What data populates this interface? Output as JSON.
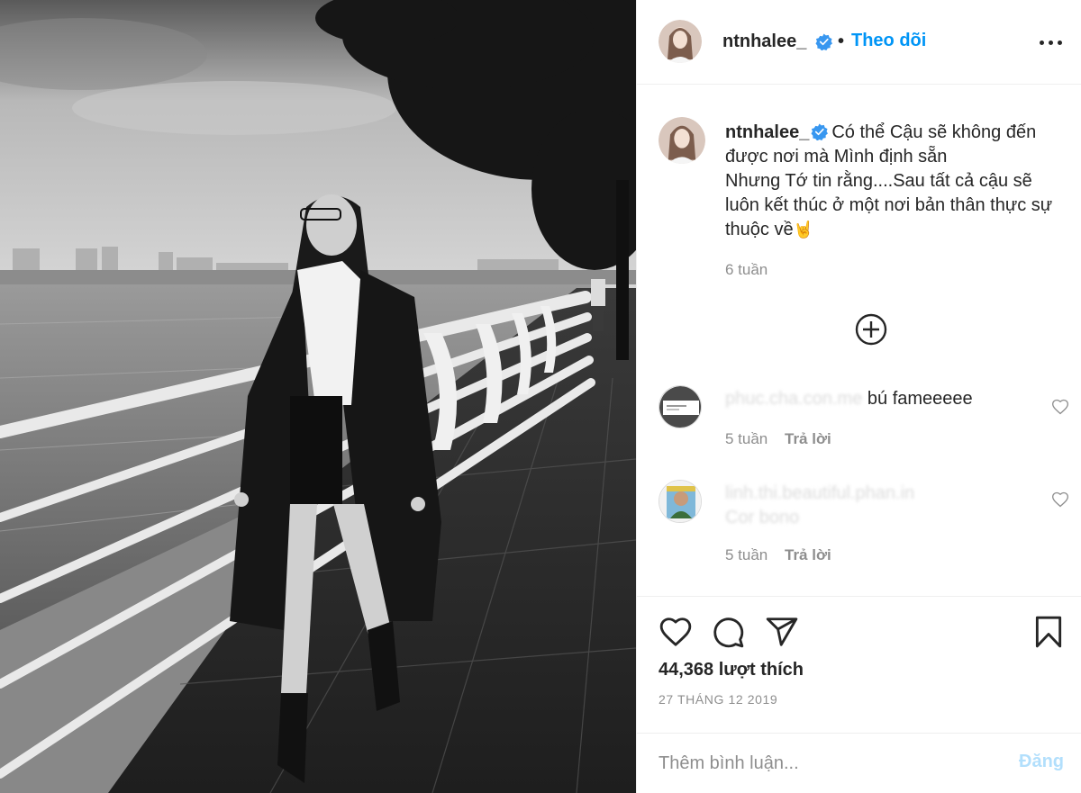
{
  "post": {
    "author": {
      "username": "ntnhalee_",
      "verified": true,
      "follow_label": "Theo dõi",
      "separator": "•"
    },
    "caption": {
      "line1": "Có thể Cậu sẽ không đến được nơi mà Mình định sẵn",
      "line2": "Nhưng Tớ tin rằng....Sau tất cả cậu sẽ luôn kết thúc ở một nơi bản thân thực sự thuộc về",
      "emoji": "🤘",
      "time": "6 tuần"
    },
    "comments": [
      {
        "username": "phuc.cha.con.me",
        "text": "bú fameeeee",
        "time": "5 tuần",
        "reply_label": "Trả lời"
      },
      {
        "username": "linh.thi.beautiful.phan.in",
        "text": "Cor bono",
        "time": "5 tuần",
        "reply_label": "Trả lời"
      }
    ],
    "likes_text": "44,368 lượt thích",
    "date_text": "27 THÁNG 12 2019",
    "add_comment": {
      "placeholder": "Thêm bình luận...",
      "post_label": "Đăng"
    }
  },
  "colors": {
    "link_blue": "#0095f6",
    "post_disabled": "#b2dffc",
    "verified_blue": "#3897f0",
    "secondary_text": "#8e8e8e",
    "primary_text": "#262626",
    "divider": "#efefef"
  },
  "icons": {
    "more": "more-horizontal-icon",
    "verified": "verified-badge-icon",
    "load_more": "plus-circle-icon",
    "like": "heart-icon",
    "comment": "comment-bubble-icon",
    "share": "paper-plane-icon",
    "save": "bookmark-icon"
  }
}
